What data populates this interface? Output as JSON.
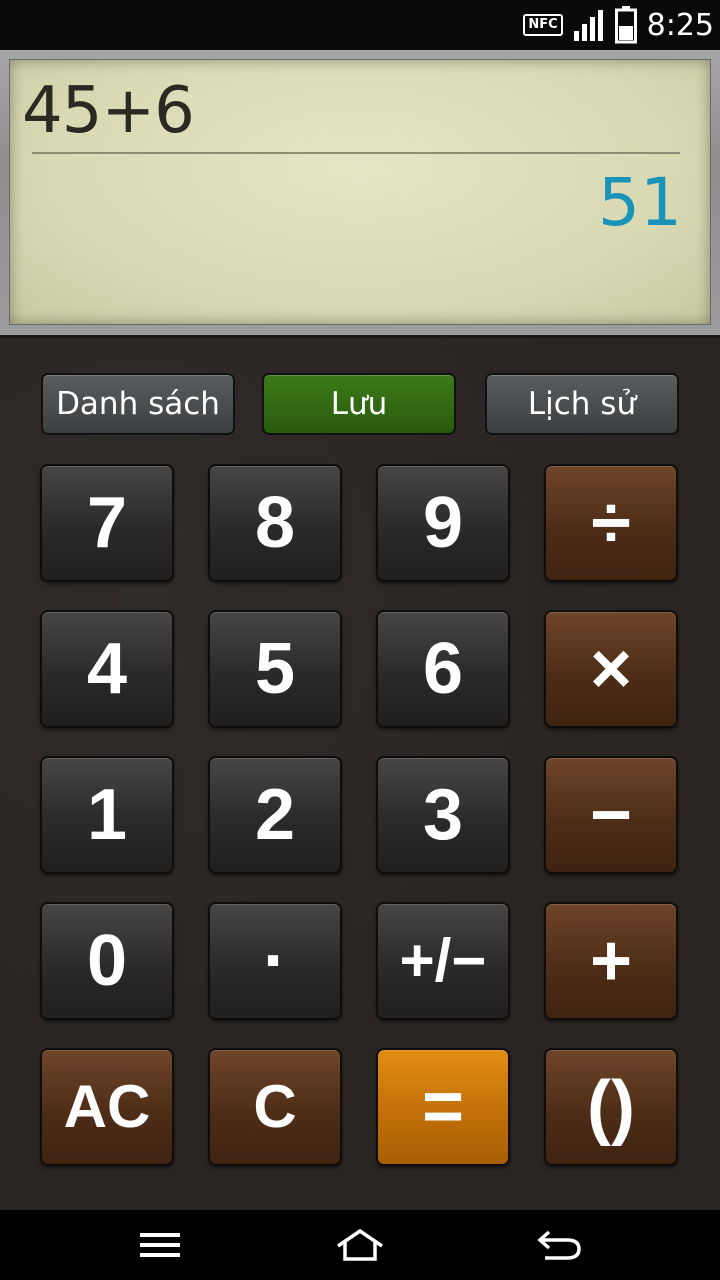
{
  "status_bar": {
    "nfc_label": "NFC",
    "time": "8:25",
    "icons": [
      "nfc-icon",
      "signal-icon",
      "battery-icon"
    ]
  },
  "display": {
    "expression": "45+6",
    "result": "51",
    "result_color": "#1a93b8"
  },
  "function_buttons": {
    "list_label": "Danh sách",
    "save_label": "Lưu",
    "history_label": "Lịch sử"
  },
  "keys": {
    "k7": "7",
    "k8": "8",
    "k9": "9",
    "divide": "÷",
    "k4": "4",
    "k5": "5",
    "k6": "6",
    "multiply": "×",
    "k1": "1",
    "k2": "2",
    "k3": "3",
    "minus": "−",
    "k0": "0",
    "dot": "·",
    "sign": "+/−",
    "plus": "+",
    "ac": "AC",
    "clear": "C",
    "equals": "=",
    "parens": "()"
  },
  "colors": {
    "accent_green": "#2f6a12",
    "operator_brown": "#5a3520",
    "equals_orange": "#d07f0c"
  },
  "nav_bar": {
    "icons": [
      "menu-icon",
      "home-icon",
      "back-icon"
    ]
  }
}
